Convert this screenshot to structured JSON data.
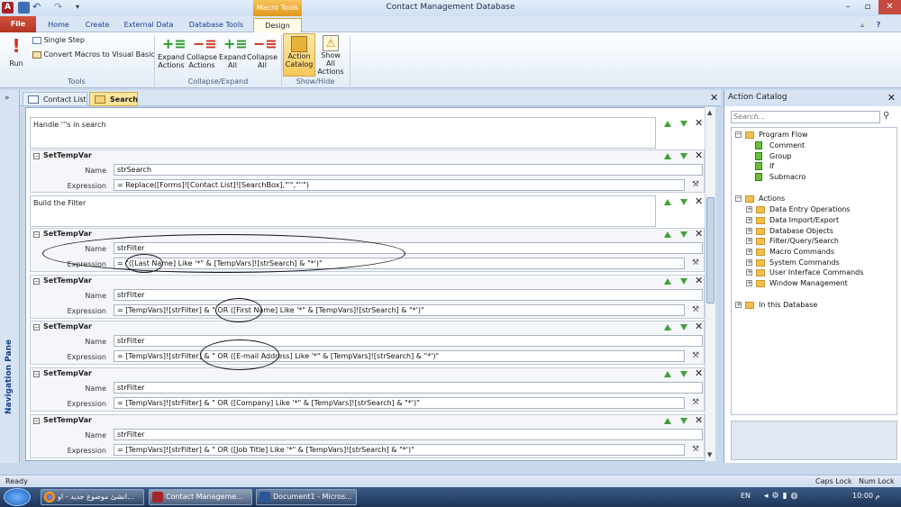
{
  "titlebar": {
    "title": "Contact Management Database",
    "contextual_tab": "Macro Tools"
  },
  "ribbon_tabs": [
    "File",
    "Home",
    "Create",
    "External Data",
    "Database Tools",
    "Design"
  ],
  "ribbon": {
    "tools": {
      "run": "Run",
      "single_step": "Single Step",
      "convert": "Convert Macros to Visual Basic",
      "label": "Tools"
    },
    "collapse_expand": {
      "expand_actions": [
        "Expand",
        "Actions"
      ],
      "collapse_actions": [
        "Collapse",
        "Actions"
      ],
      "expand_all": [
        "Expand",
        "All"
      ],
      "collapse_all": [
        "Collapse",
        "All"
      ],
      "label": "Collapse/Expand"
    },
    "show_hide": {
      "action_catalog": [
        "Action",
        "Catalog"
      ],
      "show_all": [
        "Show All",
        "Actions"
      ],
      "label": "Show/Hide"
    }
  },
  "nav_pane": {
    "label": "Navigation Pane"
  },
  "doc_tabs": [
    "Contact List",
    "Search"
  ],
  "macro": {
    "comment1": "Handle '''s in search",
    "comment2": "Build the Filter",
    "name_label": "Name",
    "expr_label": "Expression",
    "blocks": [
      {
        "title": "SetTempVar",
        "name": "strSearch",
        "expression": "= Replace([Forms]![Contact List]![SearchBox],\"'\",\"''\")"
      },
      {
        "title": "SetTempVar",
        "name": "strFilter",
        "expression": "= \"([Last Name] Like '*\" & [TempVars]![strSearch] & \"*')\""
      },
      {
        "title": "SetTempVar",
        "name": "strFilter",
        "expression": "= [TempVars]![strFilter] & \" OR ([First Name] Like '*\" & [TempVars]![strSearch] & \"*')\""
      },
      {
        "title": "SetTempVar",
        "name": "strFilter",
        "expression": "= [TempVars]![strFilter] & \" OR ([E-mail Address] Like '*\" & [TempVars]![strSearch] & \"*')\""
      },
      {
        "title": "SetTempVar",
        "name": "strFilter",
        "expression": "= [TempVars]![strFilter] & \" OR ([Company] Like '*\" & [TempVars]![strSearch] & \"*')\""
      },
      {
        "title": "SetTempVar",
        "name": "strFilter",
        "expression": "= [TempVars]![strFilter] & \" OR ([Job Title] Like '*\" & [TempVars]![strSearch] & \"*')\""
      }
    ]
  },
  "catalog": {
    "title": "Action Catalog",
    "search_placeholder": "Search...",
    "program_flow": "Program Flow",
    "flow_items": [
      "Comment",
      "Group",
      "If",
      "Submacro"
    ],
    "actions": "Actions",
    "action_items": [
      "Data Entry Operations",
      "Data Import/Export",
      "Database Objects",
      "Filter/Query/Search",
      "Macro Commands",
      "System Commands",
      "User Interface Commands",
      "Window Management"
    ],
    "in_db": "In this Database"
  },
  "status": {
    "left": "Ready",
    "caps": "Caps Lock",
    "num": "Num Lock"
  },
  "taskbar": {
    "items": [
      "انشئ موضوع جديد - او...",
      "Contact Manageme...",
      "Document1 - Micros..."
    ],
    "lang": "EN",
    "time": "10:00 م"
  }
}
